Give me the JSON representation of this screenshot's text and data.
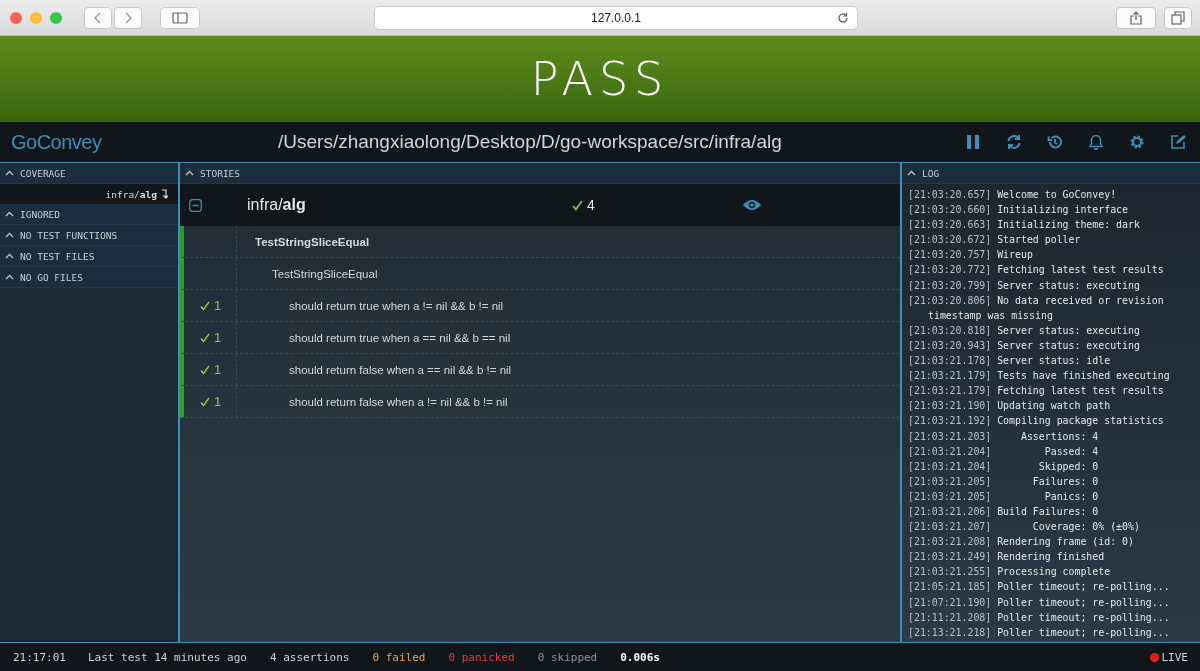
{
  "browser": {
    "address": "127.0.0.1"
  },
  "banner": {
    "status": "PASS",
    "kind": "pass"
  },
  "header": {
    "logo": "GoConvey",
    "path": "/Users/zhangxiaolong/Desktop/D/go-workspace/src/infra/alg"
  },
  "sidebar": {
    "sections": [
      {
        "title": "COVERAGE",
        "expanded": true,
        "items": [
          {
            "label": "infra/**alg**"
          }
        ]
      },
      {
        "title": "IGNORED",
        "expanded": true
      },
      {
        "title": "NO TEST FUNCTIONS",
        "expanded": true
      },
      {
        "title": "NO TEST FILES",
        "expanded": true
      },
      {
        "title": "NO GO FILES",
        "expanded": true
      }
    ]
  },
  "stories": {
    "title": "STORIES",
    "expanded": true,
    "package": {
      "name": "infra/**alg**",
      "expanded": true,
      "passed": "4"
    },
    "tests": [
      {
        "title": "TestStringSliceEqual",
        "ok": true,
        "children": [
          {
            "title": "TestStringSliceEqual",
            "ok": true,
            "children": [
              {
                "title": "should return true when a != nil && b != nil",
                "ok": true,
                "passed": "1"
              },
              {
                "title": "should return true when a == nil && b == nil",
                "ok": true,
                "passed": "1"
              },
              {
                "title": "should return false when a == nil && b != nil",
                "ok": true,
                "passed": "1"
              },
              {
                "title": "should return false when a != nil && b != nil",
                "ok": true,
                "passed": "1"
              }
            ]
          }
        ]
      }
    ]
  },
  "log": {
    "title": "LOG",
    "expanded": true,
    "entries": [
      {
        "time": "[21:03:20.657]",
        "message": "Welcome to GoConvey!"
      },
      {
        "time": "[21:03:20.660]",
        "message": "Initializing interface"
      },
      {
        "time": "[21:03:20.663]",
        "message": "Initializing theme: dark"
      },
      {
        "time": "[21:03:20.672]",
        "message": "Started poller"
      },
      {
        "time": "[21:03:20.757]",
        "message": "Wireup"
      },
      {
        "time": "[21:03:20.772]",
        "message": "Fetching latest test results"
      },
      {
        "time": "[21:03:20.799]",
        "message": "Server status: executing"
      },
      {
        "time": "[21:03:20.806]",
        "message": "No data received or revision timestamp was missing"
      },
      {
        "time": "[21:03:20.818]",
        "message": "Server status: executing"
      },
      {
        "time": "[21:03:20.943]",
        "message": "Server status: executing"
      },
      {
        "time": "[21:03:21.178]",
        "message": "Server status: idle"
      },
      {
        "time": "[21:03:21.179]",
        "message": "Tests have finished executing"
      },
      {
        "time": "[21:03:21.179]",
        "message": "Fetching latest test results"
      },
      {
        "time": "[21:03:21.190]",
        "message": "Updating watch path"
      },
      {
        "time": "[21:03:21.192]",
        "message": "Compiling package statistics"
      },
      {
        "time": "[21:03:21.203]",
        "message": "    Assertions: 4"
      },
      {
        "time": "[21:03:21.204]",
        "message": "        Passed: 4"
      },
      {
        "time": "[21:03:21.204]",
        "message": "       Skipped: 0"
      },
      {
        "time": "[21:03:21.205]",
        "message": "      Failures: 0"
      },
      {
        "time": "[21:03:21.205]",
        "message": "        Panics: 0"
      },
      {
        "time": "[21:03:21.206]",
        "message": "Build Failures: 0"
      },
      {
        "time": "[21:03:21.207]",
        "message": "      Coverage: 0% (±0%)"
      },
      {
        "time": "[21:03:21.208]",
        "message": "Rendering frame (id: 0)"
      },
      {
        "time": "[21:03:21.249]",
        "message": "Rendering finished"
      },
      {
        "time": "[21:03:21.255]",
        "message": "Processing complete"
      },
      {
        "time": "[21:05:21.185]",
        "message": "Poller timeout; re-polling..."
      },
      {
        "time": "[21:07:21.190]",
        "message": "Poller timeout; re-polling..."
      },
      {
        "time": "[21:11:21.208]",
        "message": "Poller timeout; re-polling..."
      },
      {
        "time": "[21:13:21.218]",
        "message": "Poller timeout; re-polling..."
      }
    ]
  },
  "status_bar": {
    "items": [
      {
        "kind": "time",
        "text": "21:17:01"
      },
      {
        "kind": "plain",
        "text": "Last test 14 minutes ago"
      },
      {
        "kind": "plain",
        "text": "4 assertions"
      },
      {
        "kind": "failed",
        "text": "0 failed"
      },
      {
        "kind": "panicked",
        "text": "0 panicked"
      },
      {
        "kind": "skipped",
        "text": "0 skipped"
      },
      {
        "kind": "duration",
        "text": "0.006s"
      }
    ],
    "live": {
      "label": "LIVE",
      "on": true
    }
  }
}
